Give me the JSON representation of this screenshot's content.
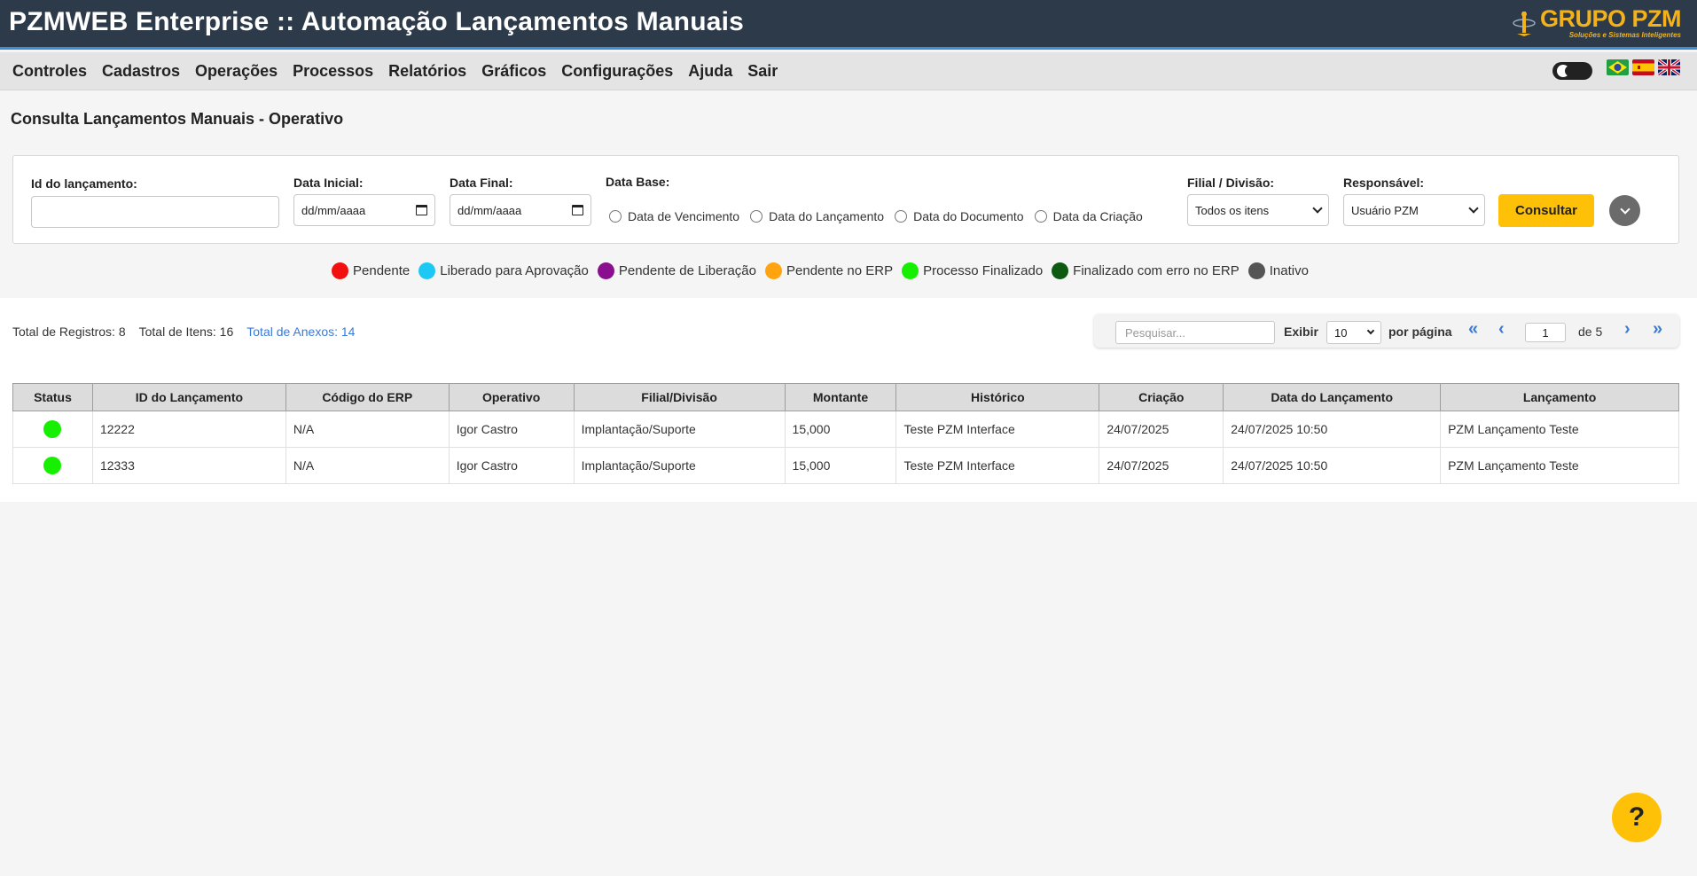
{
  "header": {
    "title": "PZMWEB Enterprise :: Automação Lançamentos Manuais",
    "logo_name": "GRUPO PZM",
    "logo_tagline": "Soluções e Sistemas Inteligentes"
  },
  "menu": {
    "items": [
      "Controles",
      "Cadastros",
      "Operações",
      "Processos",
      "Relatórios",
      "Gráficos",
      "Configurações",
      "Ajuda",
      "Sair"
    ],
    "languages": [
      "pt-BR",
      "es",
      "en"
    ]
  },
  "page": {
    "title": "Consulta Lançamentos Manuais - Operativo"
  },
  "filters": {
    "id_label": "Id do lançamento:",
    "id_value": "",
    "data_inicial_label": "Data Inicial:",
    "data_inicial_value": "dd/mm/aaaa",
    "data_final_label": "Data Final:",
    "data_final_value": "dd/mm/aaaa",
    "data_base_label": "Data Base:",
    "data_base_options": [
      "Data de Vencimento",
      "Data do Lançamento",
      "Data do Documento",
      "Data da Criação"
    ],
    "filial_label": "Filial / Divisão:",
    "filial_value": "Todos os itens",
    "responsavel_label": "Responsável:",
    "responsavel_value": "Usuário PZM",
    "consultar_label": "Consultar"
  },
  "legend": [
    {
      "label": "Pendente",
      "color": "#f10f0f"
    },
    {
      "label": "Liberado para Aprovação",
      "color": "#1ec8f5"
    },
    {
      "label": "Pendente de Liberação",
      "color": "#8a0f8f"
    },
    {
      "label": "Pendente no ERP",
      "color": "#ffa40e"
    },
    {
      "label": "Processo Finalizado",
      "color": "#16f000"
    },
    {
      "label": "Finalizado com erro no ERP",
      "color": "#0d5a10"
    },
    {
      "label": "Inativo",
      "color": "#555555"
    }
  ],
  "totals": {
    "registros": "Total de Registros: 8",
    "itens": "Total de Itens: 16",
    "anexos": "Total de Anexos: 14"
  },
  "pager": {
    "search_placeholder": "Pesquisar...",
    "show_label": "Exibir",
    "page_size": "10",
    "per_page_label": "por página",
    "current_page": "1",
    "of_label": "de 5",
    "first": "«",
    "prev": "‹",
    "next": "›",
    "last": "»"
  },
  "table": {
    "columns": [
      "Status",
      "ID do Lançamento",
      "Código do ERP",
      "Operativo",
      "Filial/Divisão",
      "Montante",
      "Histórico",
      "Criação",
      "Data do Lançamento",
      "Lançamento"
    ],
    "rows": [
      {
        "status_color": "#16f000",
        "id": "12222",
        "erp": "N/A",
        "operativo": "Igor Castro",
        "filial": "Implantação/Suporte",
        "montante": "15,000",
        "historico": "Teste PZM Interface",
        "criacao": "24/07/2025",
        "data_lancamento": "24/07/2025 10:50",
        "lancamento": "PZM Lançamento Teste"
      },
      {
        "status_color": "#16f000",
        "id": "12333",
        "erp": "N/A",
        "operativo": "Igor Castro",
        "filial": "Implantação/Suporte",
        "montante": "15,000",
        "historico": "Teste PZM Interface",
        "criacao": "24/07/2025",
        "data_lancamento": "24/07/2025 10:50",
        "lancamento": "PZM Lançamento Teste"
      }
    ]
  },
  "help": {
    "label": "?"
  }
}
